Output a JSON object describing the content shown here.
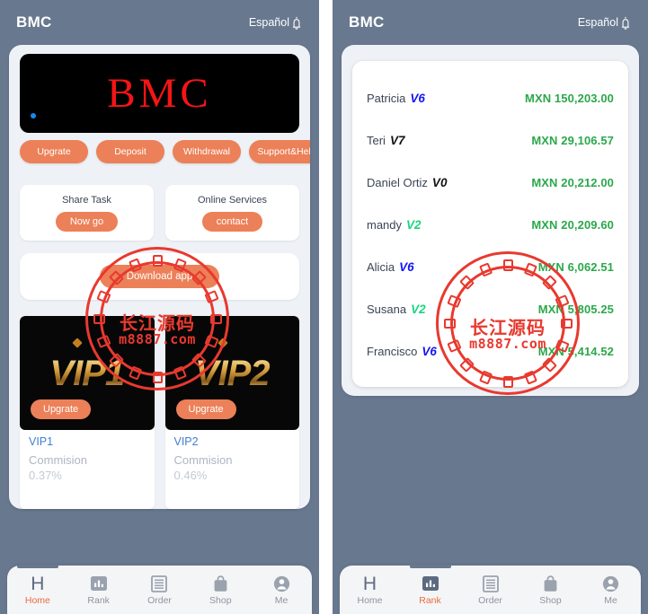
{
  "header": {
    "title": "BMC",
    "language": "Español",
    "bell_icon": "bell-icon"
  },
  "home": {
    "banner": {
      "text": "BMC",
      "indicator_color": "#1a86f0",
      "background": "#000000",
      "text_color": "#f41515"
    },
    "quick_actions": [
      {
        "label": "Upgrate"
      },
      {
        "label": "Deposit"
      },
      {
        "label": "Withdrawal"
      },
      {
        "label": "Support&Help"
      }
    ],
    "mini_cards": [
      {
        "title": "Share Task",
        "button": "Now go"
      },
      {
        "title": "Online Services",
        "button": "contact"
      }
    ],
    "download": {
      "button": "Download app"
    },
    "vip_items": [
      {
        "image_label": "VIP1",
        "upgrade_label": "Upgrate",
        "name": "VIP1",
        "commission_label": "Commision",
        "commission_value": "0.37%"
      },
      {
        "image_label": "VIP2",
        "upgrade_label": "Upgrate",
        "name": "VIP2",
        "commission_label": "Commision",
        "commission_value": "0.46%"
      }
    ]
  },
  "rank": {
    "rows": [
      {
        "name": "Patricia",
        "level": "6",
        "level_color": "#1414f5",
        "amount": "MXN 150,203.00"
      },
      {
        "name": "Teri",
        "level": "7",
        "level_color": "#121212",
        "amount": "MXN 29,106.57"
      },
      {
        "name": "Daniel Ortiz",
        "level": "0",
        "level_color": "#121212",
        "amount": "MXN 20,212.00"
      },
      {
        "name": "mandy",
        "level": "2",
        "level_color": "#17d67f",
        "amount": "MXN 20,209.60"
      },
      {
        "name": "Alicia",
        "level": "6",
        "level_color": "#1414f5",
        "amount": "MXN 6,062.51"
      },
      {
        "name": "Susana",
        "level": "2",
        "level_color": "#17d67f",
        "amount": "MXN 5,805.25"
      },
      {
        "name": "Francisco",
        "level": "6",
        "level_color": "#1414f5",
        "amount": "MXN 5,414.52"
      }
    ],
    "badge_prefix": "V",
    "amount_color": "#2aa84a"
  },
  "tabbar": {
    "items": [
      {
        "label": "Home",
        "icon": "home-icon"
      },
      {
        "label": "Rank",
        "icon": "bar-chart-icon"
      },
      {
        "label": "Order",
        "icon": "list-icon"
      },
      {
        "label": "Shop",
        "icon": "shopping-bag-icon"
      },
      {
        "label": "Me",
        "icon": "person-icon"
      }
    ],
    "left_active": "Home",
    "right_active": "Rank",
    "active_color": "#ec6a3c",
    "inactive_color": "#8d949f"
  },
  "watermark": {
    "chinese": "长江源码",
    "domain": "m8887.com",
    "color": "#e8392f"
  },
  "theme": {
    "app_background": "#68788f",
    "accent": "#ec8058",
    "card_background": "#eef1f6"
  }
}
